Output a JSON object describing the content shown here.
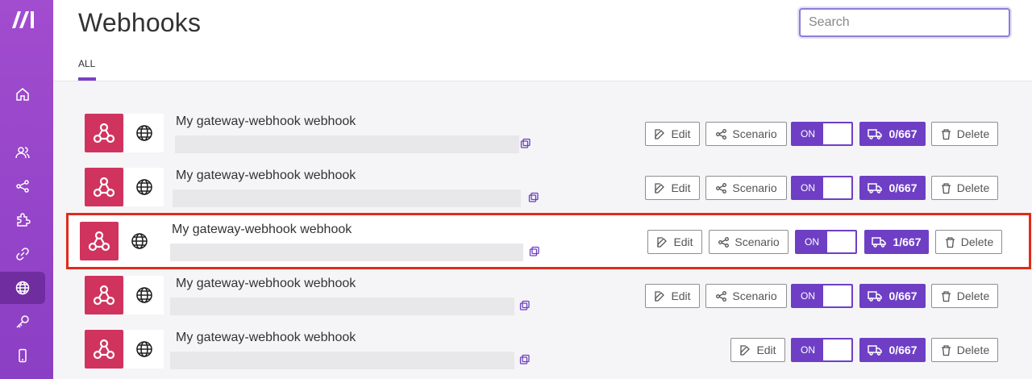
{
  "app": {
    "title": "Webhooks"
  },
  "header": {
    "tab_all": "ALL",
    "search_placeholder": "Search"
  },
  "sidebar": {
    "items": [
      "home-icon",
      "users-icon",
      "share-icon",
      "puzzle-icon",
      "link-icon",
      "globe-icon",
      "key-icon",
      "mobile-icon"
    ],
    "active": "globe-icon"
  },
  "colors": {
    "sidebar": "#9a45cc",
    "accent": "#6e3fc4",
    "webhook_icon_bg": "#d0345e",
    "highlight": "#e02b1c"
  },
  "rows": [
    {
      "name": "My gateway-webhook webhook",
      "edit": "Edit",
      "scenario": "Scenario",
      "toggle": "ON",
      "ops": "0/667",
      "delete": "Delete"
    },
    {
      "name": "My gateway-webhook webhook",
      "edit": "Edit",
      "scenario": "Scenario",
      "toggle": "ON",
      "ops": "0/667",
      "delete": "Delete"
    },
    {
      "name": "My gateway-webhook webhook",
      "edit": "Edit",
      "scenario": "Scenario",
      "toggle": "ON",
      "ops": "1/667",
      "delete": "Delete"
    },
    {
      "name": "My gateway-webhook webhook",
      "edit": "Edit",
      "scenario": "Scenario",
      "toggle": "ON",
      "ops": "0/667",
      "delete": "Delete"
    },
    {
      "name": "My gateway-webhook webhook",
      "edit": "Edit",
      "toggle": "ON",
      "ops": "0/667",
      "delete": "Delete"
    }
  ]
}
